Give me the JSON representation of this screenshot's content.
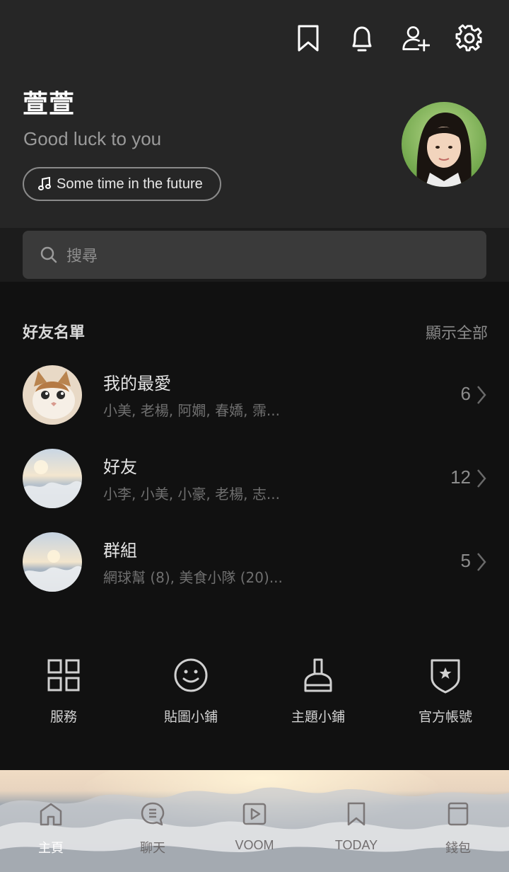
{
  "header": {
    "name": "萱萱",
    "status_message": "Good luck to you",
    "music": "Some time in the future",
    "icons": [
      "bookmark-icon",
      "bell-icon",
      "add-friend-icon",
      "gear-icon"
    ]
  },
  "search": {
    "placeholder": "搜尋"
  },
  "friends": {
    "title": "好友名單",
    "show_all": "顯示全部",
    "rows": [
      {
        "title": "我的最愛",
        "subtitle": "小美, 老楊, 阿嫺, 春嬌, 霈...",
        "count": "6"
      },
      {
        "title": "好友",
        "subtitle": "小李, 小美, 小豪, 老楊, 志...",
        "count": "12"
      },
      {
        "title": "群組",
        "subtitle": "網球幫 (8), 美食小隊 (20)...",
        "count": "5"
      }
    ]
  },
  "services": [
    {
      "label": "服務",
      "icon": "grid-icon"
    },
    {
      "label": "貼圖小鋪",
      "icon": "smiley-icon"
    },
    {
      "label": "主題小鋪",
      "icon": "brush-icon"
    },
    {
      "label": "官方帳號",
      "icon": "star-shield-icon"
    }
  ],
  "bottom_nav": [
    {
      "label": "主頁",
      "icon": "home-icon",
      "active": true
    },
    {
      "label": "聊天",
      "icon": "chat-icon",
      "active": false
    },
    {
      "label": "VOOM",
      "icon": "play-icon",
      "active": false
    },
    {
      "label": "TODAY",
      "icon": "bookmark-icon",
      "active": false
    },
    {
      "label": "錢包",
      "icon": "wallet-icon",
      "active": false
    }
  ],
  "colors": {
    "header_bg": "#262626",
    "page_bg": "#111111",
    "search_bg": "#3a3a3a"
  }
}
